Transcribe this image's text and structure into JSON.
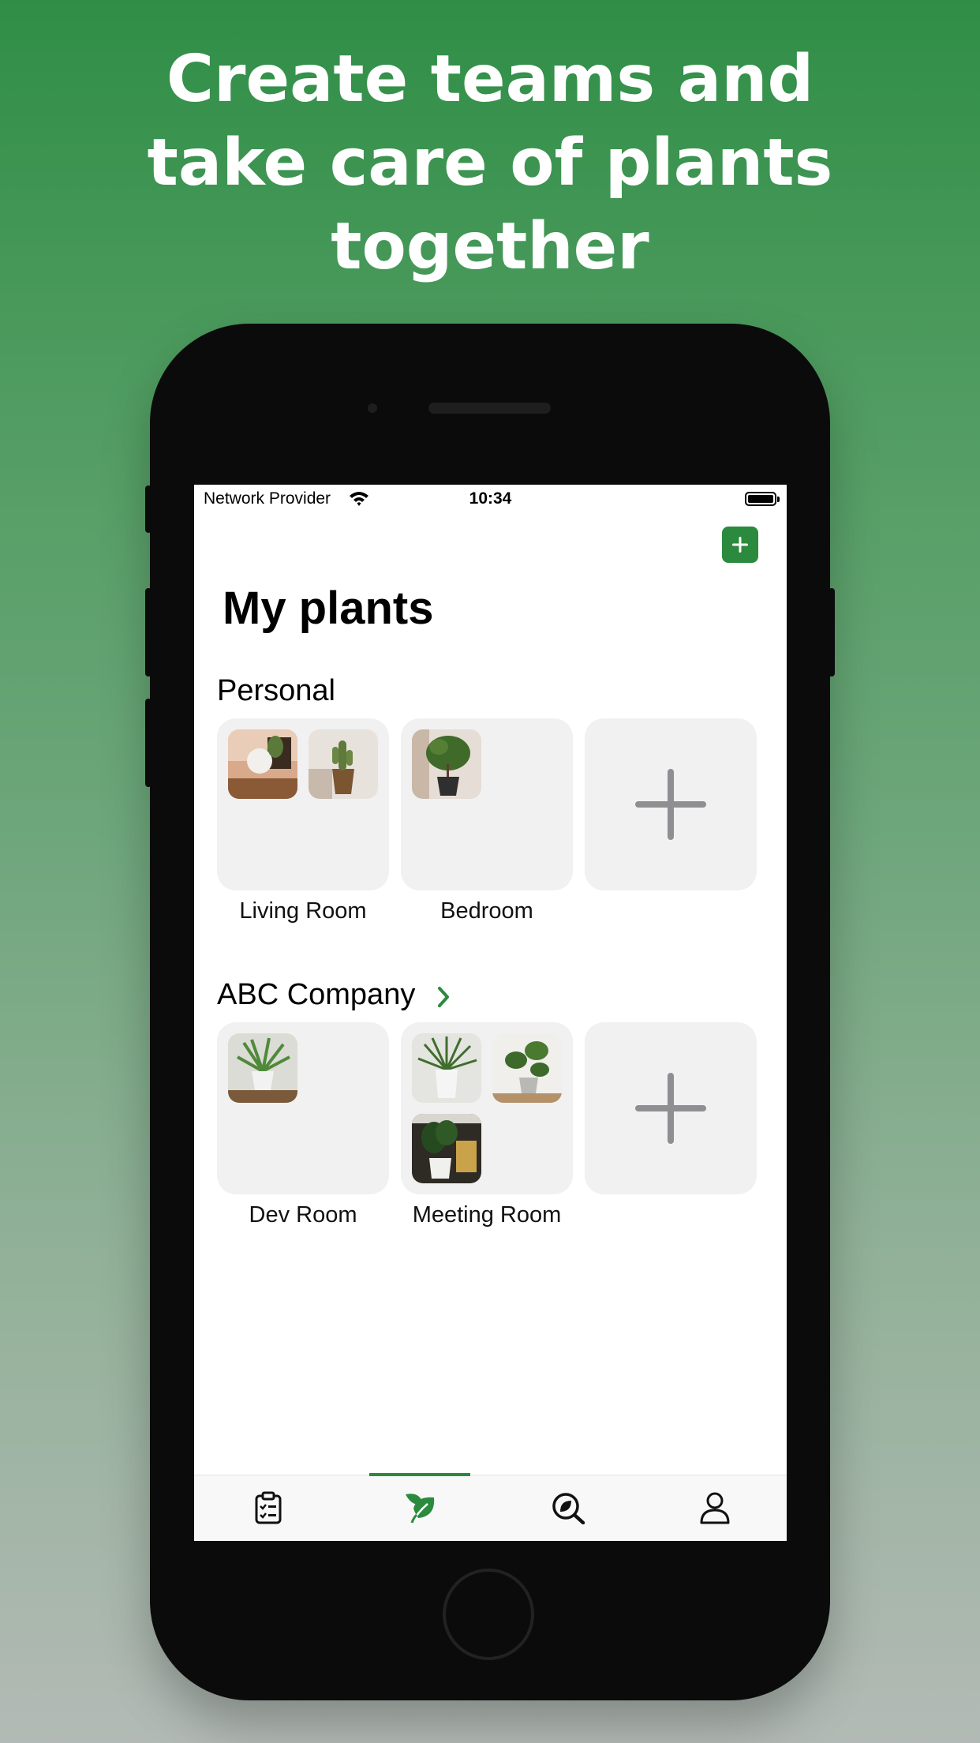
{
  "headline": {
    "line1": "Create teams and",
    "line2": "take care of plants",
    "line3": "together"
  },
  "status_bar": {
    "provider": "Network Provider",
    "time": "10:34"
  },
  "header": {
    "add_icon": "plus-icon",
    "title": "My plants"
  },
  "sections": [
    {
      "title": "Personal",
      "rooms": [
        {
          "label": "Living Room",
          "photos": 2
        },
        {
          "label": "Bedroom",
          "photos": 1
        }
      ],
      "add_room_icon": "plus-icon"
    },
    {
      "title": "ABC Company",
      "chevron_icon": "chevron-right-icon",
      "rooms": [
        {
          "label": "Dev Room",
          "photos": 1
        },
        {
          "label": "Meeting Room",
          "photos": 3
        }
      ],
      "add_room_icon": "plus-icon"
    }
  ],
  "tabbar": {
    "tabs": [
      {
        "icon": "clipboard-checklist-icon",
        "selected": false
      },
      {
        "icon": "leaf-icon",
        "selected": true
      },
      {
        "icon": "search-leaf-icon",
        "selected": false
      },
      {
        "icon": "person-icon",
        "selected": false
      }
    ]
  },
  "colors": {
    "accent": "#2b8a3e",
    "card_bg": "#f1f1f1",
    "plus_gray": "#8e8e93",
    "background_top": "#2f8e46",
    "background_bottom": "#b3bab5"
  }
}
